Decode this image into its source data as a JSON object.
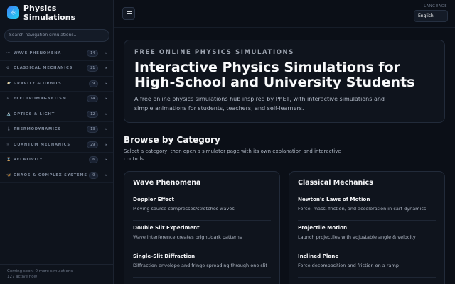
{
  "brand": {
    "title": "Physics Simulations",
    "logo_icon": "atom-icon"
  },
  "sidebar": {
    "search_placeholder": "Search navigation simulations...",
    "items": [
      {
        "icon": "〰",
        "label": "Wave Phenomena",
        "count": "14"
      },
      {
        "icon": "⚙",
        "label": "Classical Mechanics",
        "count": "21"
      },
      {
        "icon": "🪐",
        "label": "Gravity & Orbits",
        "count": "9"
      },
      {
        "icon": "⚡",
        "label": "Electromagnetism",
        "count": "14"
      },
      {
        "icon": "🔬",
        "label": "Optics & Light",
        "count": "12"
      },
      {
        "icon": "🌡",
        "label": "Thermodynamics",
        "count": "13"
      },
      {
        "icon": "⚛",
        "label": "Quantum Mechanics",
        "count": "29"
      },
      {
        "icon": "⌛",
        "label": "Relativity",
        "count": "6"
      },
      {
        "icon": "🦋",
        "label": "Chaos & Complex Systems",
        "count": "9"
      }
    ],
    "footer_line1": "Coming soon: 0 more simulations",
    "footer_line2": "127 active now"
  },
  "topbar": {
    "language_label": "LANGUAGE",
    "language_value": "English"
  },
  "hero": {
    "eyebrow": "FREE ONLINE PHYSICS SIMULATIONS",
    "title": "Interactive Physics Simulations for High-School and University Students",
    "description": "A free online physics simulations hub inspired by PhET, with interactive simulations and simple animations for students, teachers, and self-learners."
  },
  "browse": {
    "title": "Browse by Category",
    "description": "Select a category, then open a simulator page with its own explanation and interactive controls."
  },
  "categories": [
    {
      "title": "Wave Phenomena",
      "sims": [
        {
          "name": "Doppler Effect",
          "desc": "Moving source compresses/stretches waves"
        },
        {
          "name": "Double Slit Experiment",
          "desc": "Wave interference creates bright/dark patterns"
        },
        {
          "name": "Single-Slit Diffraction",
          "desc": "Diffraction envelope and fringe spreading through one slit"
        }
      ]
    },
    {
      "title": "Classical Mechanics",
      "sims": [
        {
          "name": "Newton's Laws of Motion",
          "desc": "Force, mass, friction, and acceleration in cart dynamics"
        },
        {
          "name": "Projectile Motion",
          "desc": "Launch projectiles with adjustable angle & velocity"
        },
        {
          "name": "Inclined Plane",
          "desc": "Force decomposition and friction on a ramp"
        }
      ]
    }
  ]
}
